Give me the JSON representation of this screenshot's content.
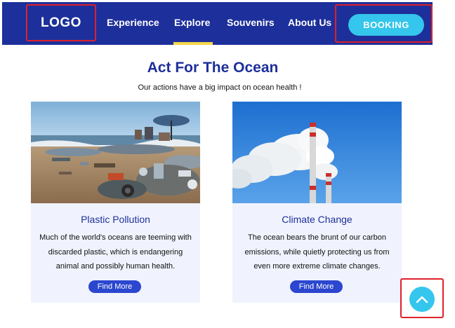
{
  "header": {
    "logo": "LOGO",
    "nav": [
      {
        "label": "Experience"
      },
      {
        "label": "Explore",
        "active": true
      },
      {
        "label": "Souvenirs"
      },
      {
        "label": "About Us"
      }
    ],
    "booking_label": "BOOKING"
  },
  "hero": {
    "title": "Act For The Ocean",
    "subtitle": "Our actions have a big impact on ocean health !"
  },
  "cards": [
    {
      "title": "Plastic Pollution",
      "description": "Much of the world's oceans are teeming with discarded plastic, which is endangering animal and possibly human health.",
      "button": "Find More",
      "image_icon": "beach-plastic-waste-photo"
    },
    {
      "title": "Climate Change",
      "description": "The ocean bears the brunt of our carbon emissions, while quietly protecting us from even more extreme climate changes.",
      "button": "Find More",
      "image_icon": "smokestack-emissions-photo"
    }
  ],
  "back_to_top_icon": "chevron-up-icon",
  "colors": {
    "navy": "#1d2f9a",
    "accent": "#34c6ec",
    "button": "#2b46cf",
    "active_indicator": "#f4d64a",
    "annotation_red": "#e0202a",
    "card_bg": "#f0f3fd"
  }
}
